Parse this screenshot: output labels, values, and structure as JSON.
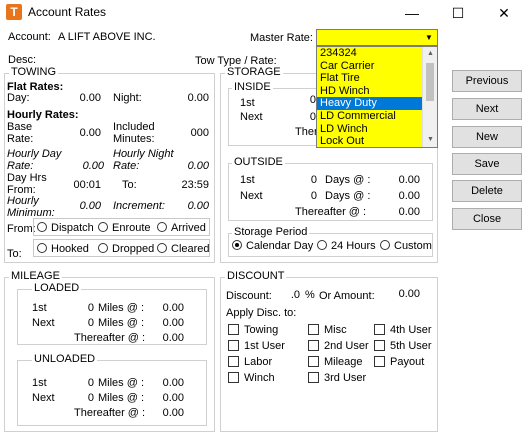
{
  "window": {
    "title": "Account Rates",
    "app_icon_letter": "T",
    "minimize": "—",
    "maximize": "☐",
    "close": "✕"
  },
  "header": {
    "account_label": "Account:",
    "account_value": "A LIFT ABOVE INC.",
    "master_rate_label": "Master Rate:",
    "desc_label": "Desc:",
    "tow_type_label": "Tow Type / Rate:"
  },
  "master_rate_dropdown": {
    "options": [
      "234324",
      "Car Carrier",
      "Flat Tire",
      "HD Winch",
      "Heavy Duty",
      "LD Commercial",
      "LD Winch",
      "Lock Out"
    ],
    "highlighted_index": 4,
    "bg_color": "#ffff00",
    "highlight_color": "#0078d7"
  },
  "towing": {
    "title": "TOWING",
    "flat_rates_label": "Flat Rates:",
    "day_label": "Day:",
    "day_value": "0.00",
    "night_label": "Night:",
    "night_value": "0.00",
    "hourly_rates_label": "Hourly Rates:",
    "base_label": "Base",
    "rate_label": "Rate:",
    "base_rate_value": "0.00",
    "included_label": "Included",
    "minutes_label": "Minutes:",
    "included_minutes_value": "000",
    "hourly_day_label": "Hourly Day",
    "hourly_day_rate_label": "Rate:",
    "hourly_day_value": "0.00",
    "hourly_night_label": "Hourly Night",
    "hourly_night_rate_label": "Rate:",
    "hourly_night_value": "0.00",
    "day_hrs_label": "Day Hrs",
    "from_label": "From:",
    "from_value": "00:01",
    "to_label": "To:",
    "to_value": "23:59",
    "hourly_label": "Hourly",
    "minimum_label": "Minimum:",
    "minimum_value": "0.00",
    "increment_label": "Increment:",
    "increment_value": "0.00",
    "from_status_label": "From:",
    "to_status_label": "To:",
    "from_options": [
      "Dispatch",
      "Enroute",
      "Arrived"
    ],
    "to_options": [
      "Hooked",
      "Dropped",
      "Cleared"
    ]
  },
  "storage": {
    "title": "STORAGE",
    "inside": {
      "title": "INSIDE",
      "first_label": "1st",
      "first_value": "0",
      "next_label": "Next",
      "next_value": "0",
      "thereafter_label": "Therea"
    },
    "outside": {
      "title": "OUTSIDE",
      "first_label": "1st",
      "first_days": "0",
      "first_days_label": "Days @ :",
      "first_rate": "0.00",
      "next_label": "Next",
      "next_days": "0",
      "next_days_label": "Days @ :",
      "next_rate": "0.00",
      "thereafter_label": "Thereafter  @ :",
      "thereafter_rate": "0.00"
    },
    "period": {
      "title": "Storage Period",
      "options": [
        "Calendar Day",
        "24 Hours",
        "Custom"
      ],
      "selected_index": 0
    }
  },
  "mileage": {
    "title": "MILEAGE",
    "loaded": {
      "title": "LOADED",
      "first_label": "1st",
      "first_miles": "0",
      "first_miles_label": "Miles @ :",
      "first_rate": "0.00",
      "next_label": "Next",
      "next_miles": "0",
      "next_miles_label": "Miles @ :",
      "next_rate": "0.00",
      "thereafter_label": "Thereafter @ :",
      "thereafter_rate": "0.00"
    },
    "unloaded": {
      "title": "UNLOADED",
      "first_label": "1st",
      "first_miles": "0",
      "first_miles_label": "Miles @ :",
      "first_rate": "0.00",
      "next_label": "Next",
      "next_miles": "0",
      "next_miles_label": "Miles @ :",
      "next_rate": "0.00",
      "thereafter_label": "Thereafter @ :",
      "thereafter_rate": "0.00"
    }
  },
  "discount": {
    "title": "DISCOUNT",
    "discount_label": "Discount:",
    "discount_value": ".0",
    "percent_label": "%",
    "or_amount_label": "Or Amount:",
    "amount_value": "0.00",
    "apply_label": "Apply Disc. to:",
    "col1": [
      "Towing",
      "1st User",
      "Labor",
      "Winch"
    ],
    "col2": [
      "Misc",
      "2nd User",
      "Mileage",
      "3rd User"
    ],
    "col3": [
      "4th User",
      "5th User",
      "Payout"
    ]
  },
  "buttons": {
    "previous": "Previous",
    "next": "Next",
    "new": "New",
    "save": "Save",
    "delete": "Delete",
    "close": "Close"
  }
}
